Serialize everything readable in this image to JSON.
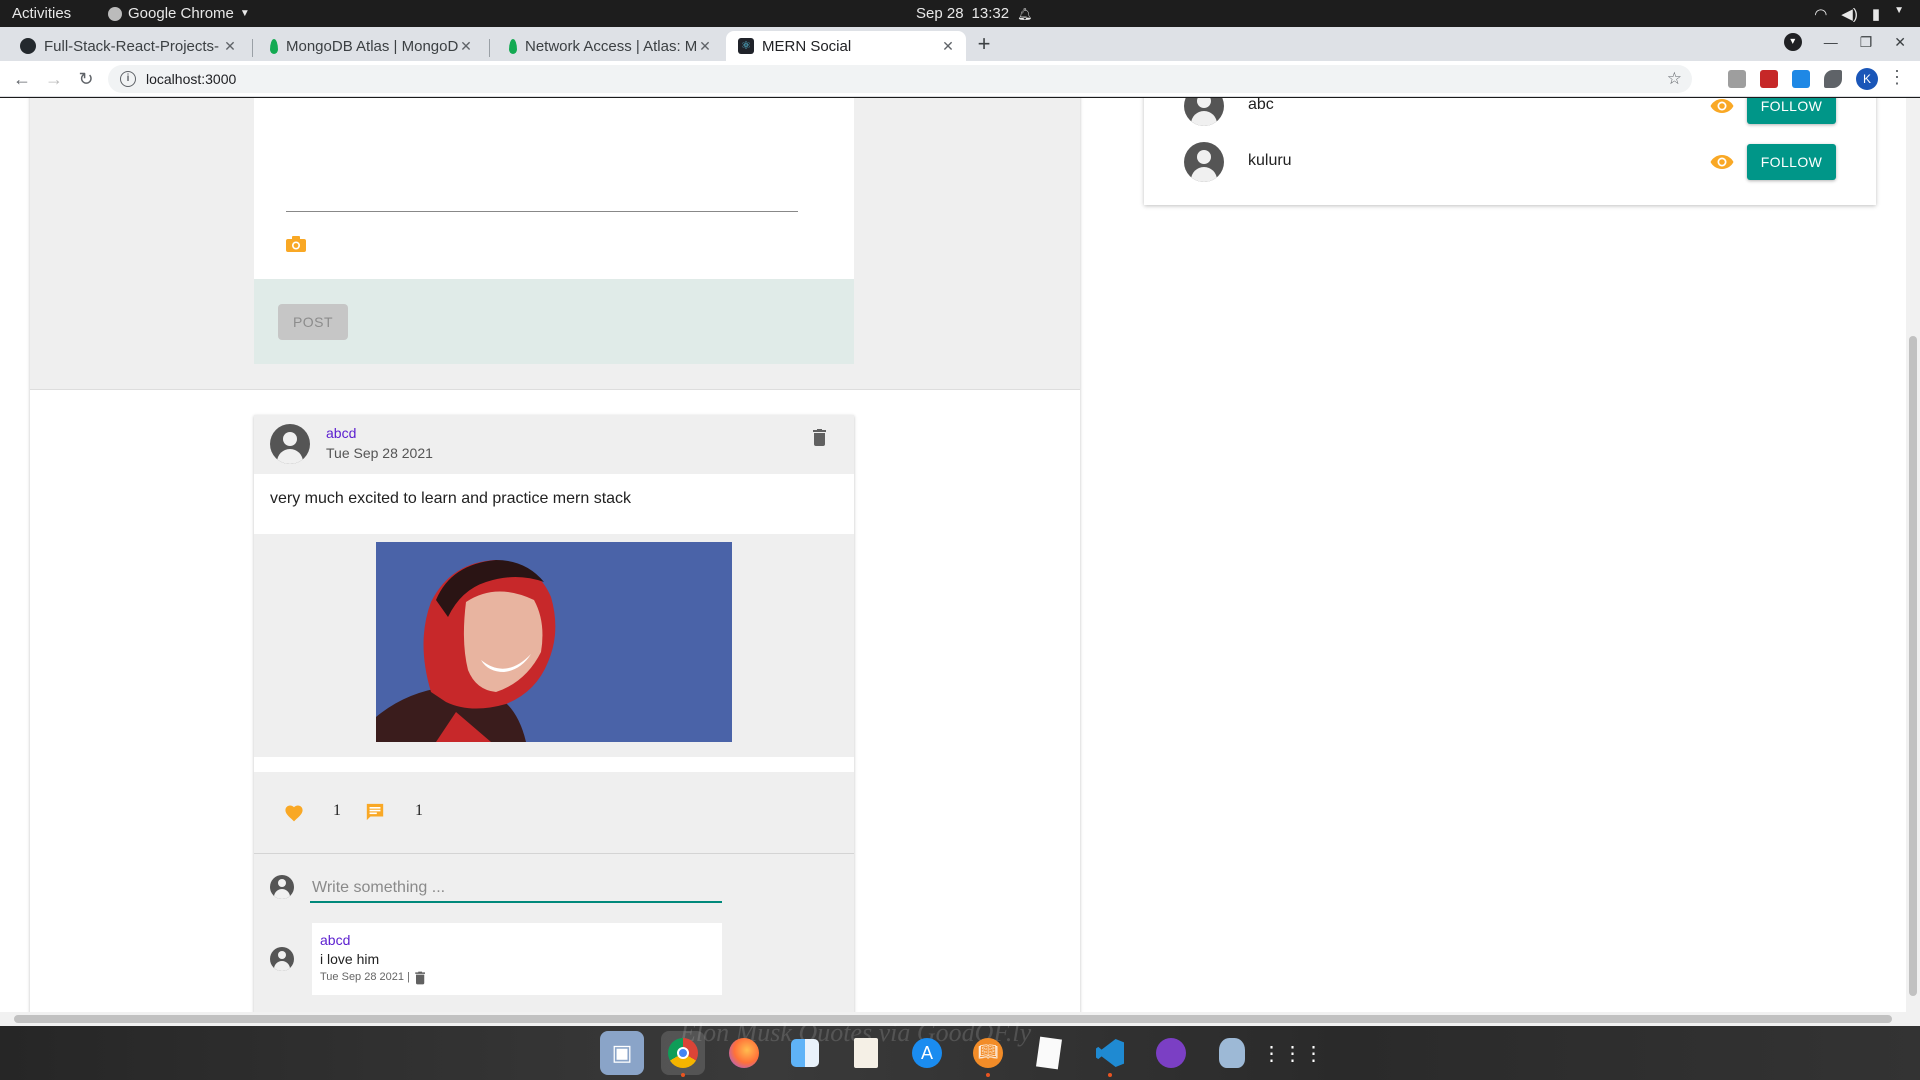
{
  "system_bar": {
    "activities": "Activities",
    "app_name": "Google Chrome",
    "date": "Sep 28",
    "time": "13:32"
  },
  "browser": {
    "tabs": [
      {
        "title": "Full-Stack-React-Projects-",
        "favicon": "github-icon"
      },
      {
        "title": "MongoDB Atlas | MongoD",
        "favicon": "mongodb-leaf-icon"
      },
      {
        "title": "Network Access | Atlas: M",
        "favicon": "mongodb-leaf-icon"
      },
      {
        "title": "MERN Social",
        "favicon": "react-icon",
        "active": true
      }
    ],
    "url": "localhost:3000",
    "profile_initial": "K"
  },
  "new_post": {
    "post_label": "POST"
  },
  "post": {
    "author": "abcd",
    "date": "Tue Sep 28 2021",
    "text": "very much excited to learn and practice mern stack",
    "likes": "1",
    "comments_count": "1",
    "comment_placeholder": "Write something ...",
    "comments": [
      {
        "author": "abcd",
        "text": "i love him",
        "date": "Tue Sep 28 2021 |"
      }
    ]
  },
  "who_to_follow": [
    {
      "name": "abc",
      "button": "FOLLOW"
    },
    {
      "name": "kuluru",
      "button": "FOLLOW"
    }
  ],
  "dock": {
    "watermark": "Elon Musk Quotes via GoodOF.ly"
  },
  "colors": {
    "accent_teal": "#009688",
    "author_link": "#5b1ecf",
    "icon_orange": "#f9a825",
    "post_image_bg": "#4a63a8"
  }
}
